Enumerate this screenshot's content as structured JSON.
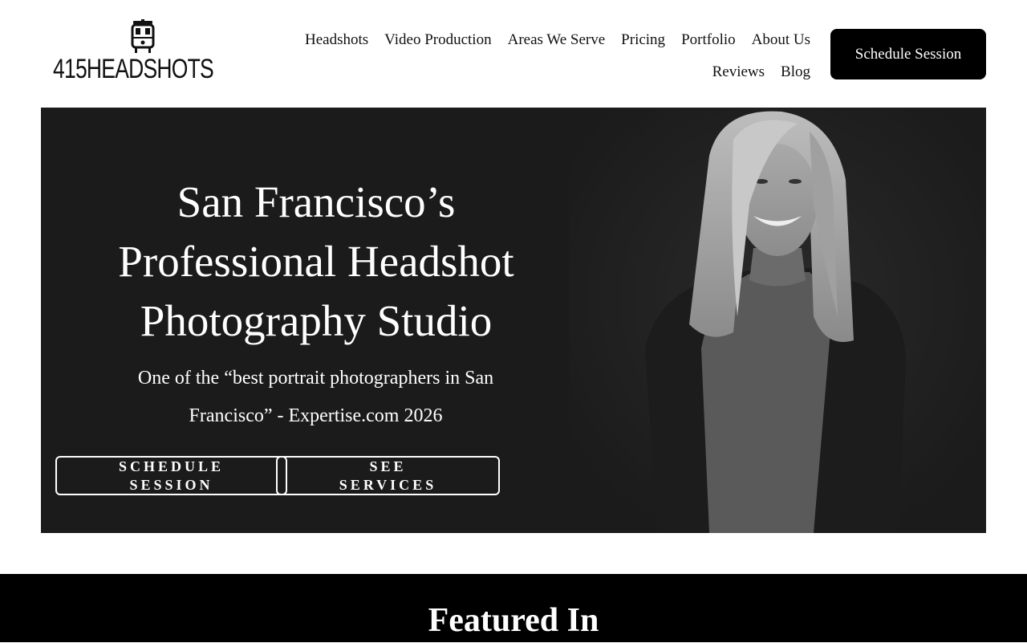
{
  "brand": {
    "logo_text": "415HEADSHOTS",
    "logo_icon": "cable-car-icon"
  },
  "nav": {
    "row1": [
      "Headshots",
      "Video Production",
      "Areas We Serve",
      "Pricing",
      "Portfolio",
      "About Us"
    ],
    "row2": [
      "Reviews",
      "Blog"
    ]
  },
  "header_cta": "Schedule Session",
  "hero": {
    "title_lines": [
      "San Francisco’s",
      "Professional Headshot",
      "Photography Studio"
    ],
    "subtitle_lines": [
      "One of the “best portrait photographers in San",
      "Francisco” - Expertise.com 2026"
    ],
    "buttons": [
      {
        "line1": "SCHEDULE",
        "line2": "SESSION"
      },
      {
        "line1": "SEE",
        "line2": "SERVICES"
      }
    ],
    "photo": "woman-headshot-portrait"
  },
  "featured": {
    "title": "Featured In"
  },
  "colors": {
    "hero_bg": "#1b1b1b",
    "accent": "#000000",
    "text_on_dark": "#ffffff"
  }
}
